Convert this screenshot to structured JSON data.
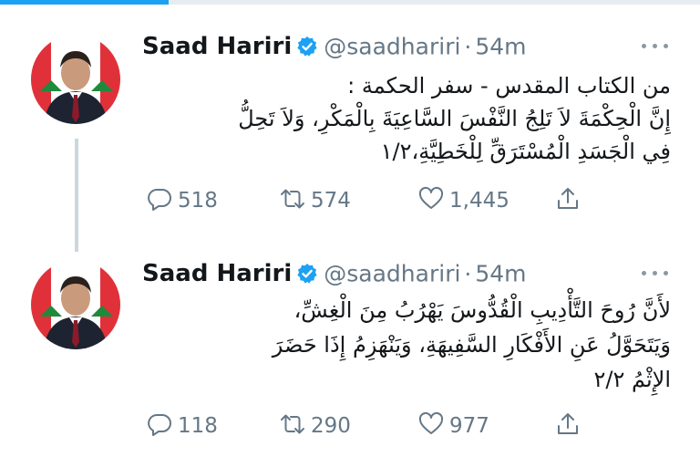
{
  "tweets": [
    {
      "name": "Saad Hariri",
      "handle": "@saadhariri",
      "separator": "·",
      "time": "54m",
      "lines": [
        "من الكتاب المقدس - سفر الحكمة :",
        "إِنَّ الْحِكْمَةَ لاَ تَلِجُ النَّفْسَ السَّاعِيَةَ بِالْمَكْرِ، وَلاَ تَحِلُّ",
        "فِي الْجَسَدِ الْمُسْتَرَقِّ لِلْخَطِيَّةِ،١/٢"
      ],
      "replies": "518",
      "retweets": "574",
      "likes": "1,445"
    },
    {
      "name": "Saad Hariri",
      "handle": "@saadhariri",
      "separator": "·",
      "time": "54m",
      "lines": [
        "لأَنَّ رُوحَ التَّأْدِيبِ الْقُدُّوسَ يَهْرُبُ مِنَ الْغِشِّ،",
        "وَيَتَحَوَّلُ عَنِ الأَفْكَارِ السَّفِيهَةِ، وَيَنْهَزِمُ إِذَا حَضَرَ",
        "الإِثْمُ ٢/٢"
      ],
      "replies": "118",
      "retweets": "290",
      "likes": "977"
    }
  ],
  "icons": {
    "reply": "reply-icon",
    "retweet": "retweet-icon",
    "like": "heart-icon",
    "share": "share-icon",
    "verified": "verified-badge-icon",
    "more": "more-options-icon"
  },
  "colors": {
    "accent": "#1da1f2",
    "secondary_text": "#657786",
    "icon": "#657786",
    "thread_line": "#ccd6dd"
  }
}
